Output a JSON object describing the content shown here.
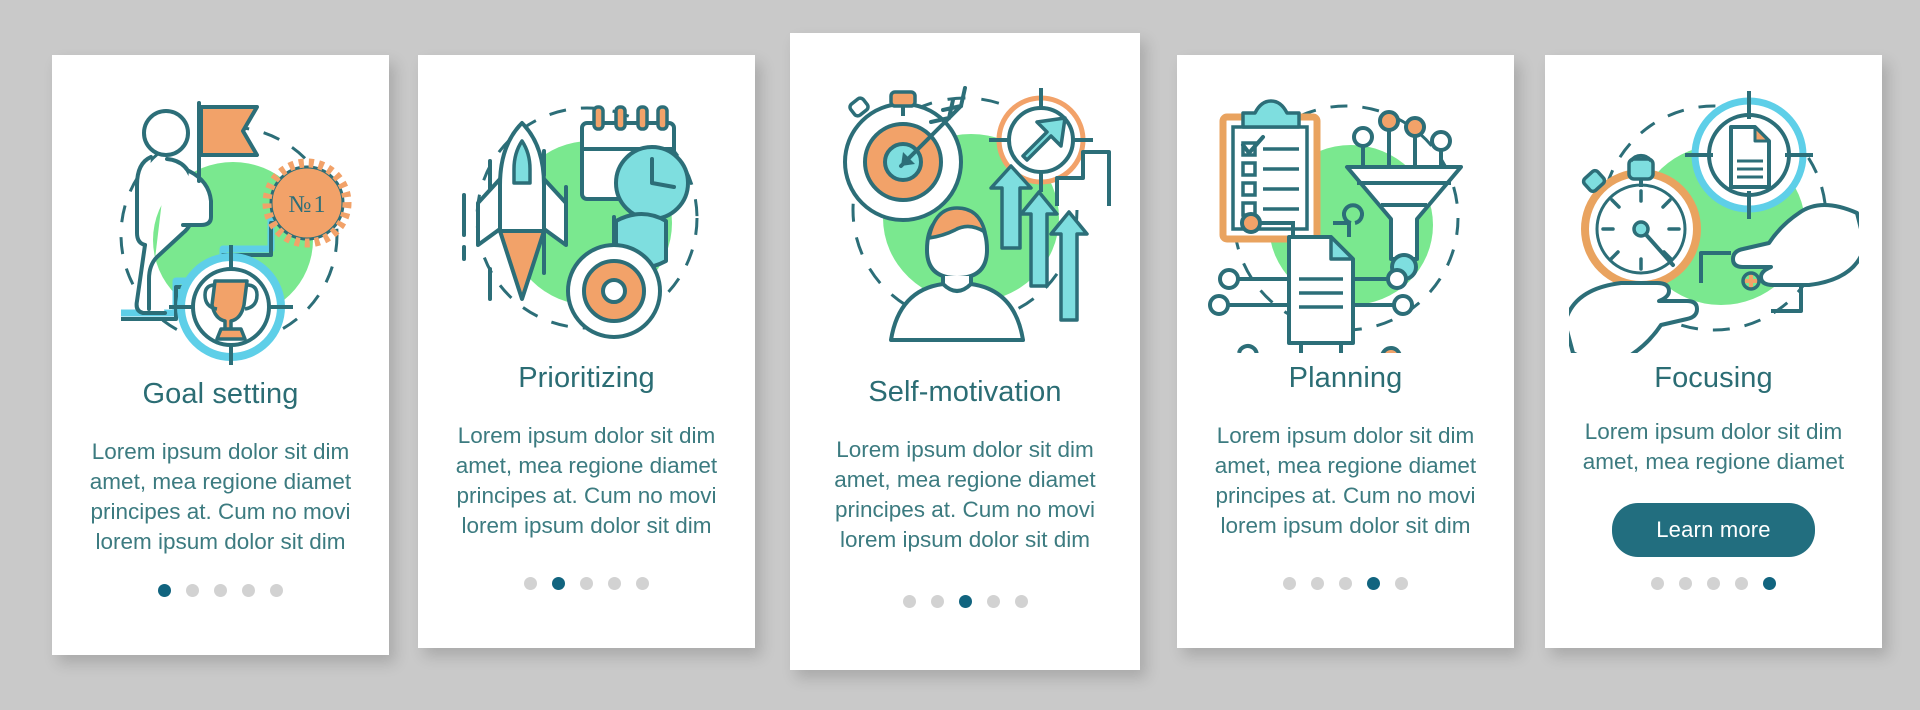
{
  "background_color": "#c9c9c9",
  "palette": {
    "title": "#2b6d74",
    "body": "#3c7b80",
    "button_bg": "#226e7f",
    "button_text": "#ffffff",
    "dot_active": "#11647f",
    "dot_inactive": "#d2d2d2",
    "accent_green": "#7ae88f",
    "accent_orange": "#f2a269",
    "accent_cyan": "#7ededf",
    "line_teal": "#2c6e78",
    "line_blue": "#5ecfe8"
  },
  "cards": [
    {
      "id": "goal-setting",
      "illustration": "goal-setting-illustration",
      "badge_label": "№ 1",
      "title": "Goal setting",
      "body": "Lorem ipsum dolor sit dim amet, mea regione diamet principes at. Cum no movi lorem ipsum dolor sit dim",
      "dots": {
        "count": 5,
        "active_index": 0
      },
      "button": null
    },
    {
      "id": "prioritizing",
      "illustration": "prioritizing-illustration",
      "title": "Prioritizing",
      "body": "Lorem ipsum dolor sit dim amet, mea regione diamet principes at. Cum no movi lorem ipsum dolor sit dim",
      "dots": {
        "count": 5,
        "active_index": 1
      },
      "button": null
    },
    {
      "id": "self-motivation",
      "illustration": "self-motivation-illustration",
      "title": "Self-motivation",
      "body": "Lorem ipsum dolor sit dim amet, mea regione diamet principes at. Cum no movi lorem ipsum dolor sit dim",
      "dots": {
        "count": 5,
        "active_index": 2
      },
      "button": null
    },
    {
      "id": "planning",
      "illustration": "planning-illustration",
      "title": "Planning",
      "body": "Lorem ipsum dolor sit dim amet, mea regione diamet principes at. Cum no movi lorem ipsum dolor sit dim",
      "dots": {
        "count": 5,
        "active_index": 3
      },
      "button": null
    },
    {
      "id": "focusing",
      "illustration": "focusing-illustration",
      "title": "Focusing",
      "body": "Lorem ipsum dolor sit dim amet, mea regione diamet",
      "dots": {
        "count": 5,
        "active_index": 4
      },
      "button": "Learn more"
    }
  ]
}
